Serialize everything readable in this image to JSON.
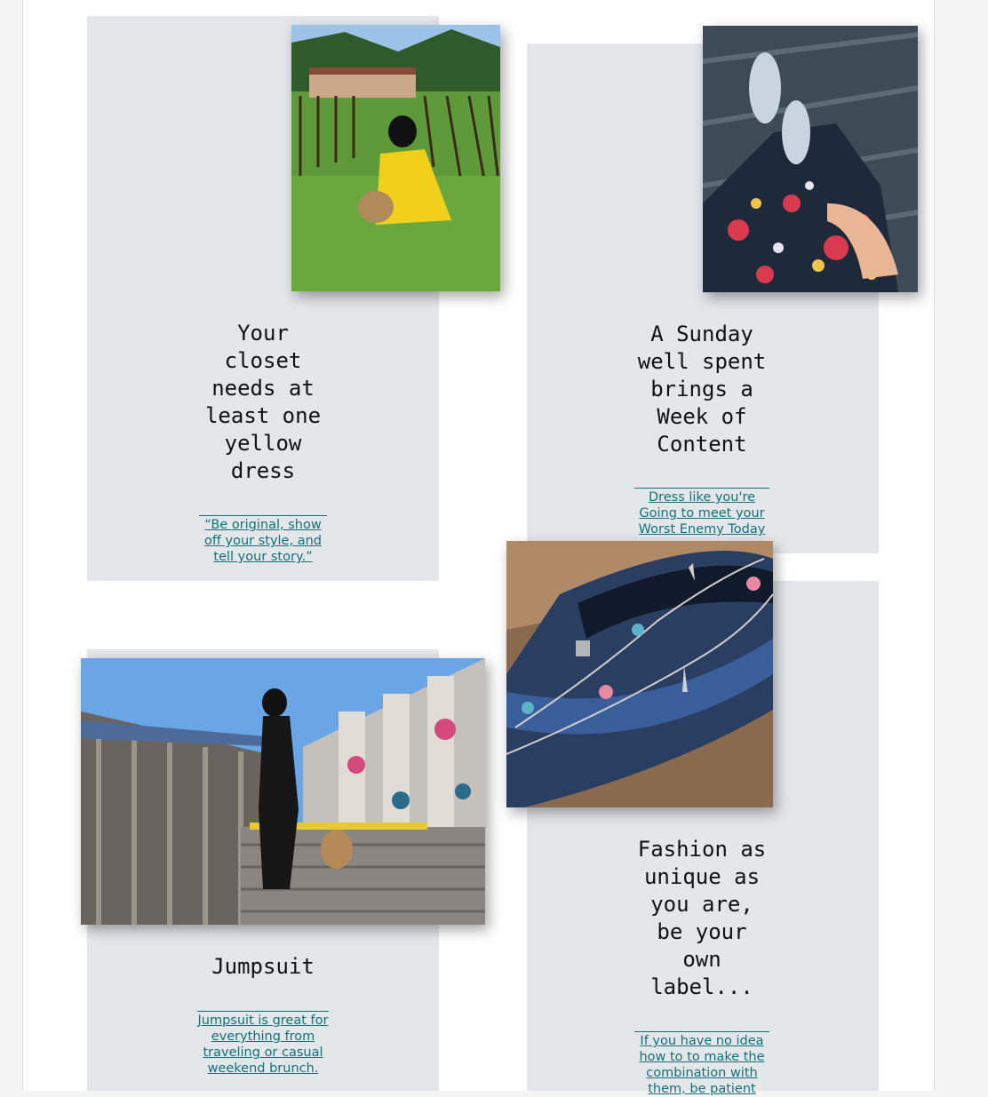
{
  "cards": [
    {
      "title": "Your closet needs at least one yellow dress",
      "link": "“Be original, show off your style, and tell your story.”",
      "photo": "woman-yellow-dress-vineyard-photo"
    },
    {
      "title": "A Sunday well spent brings a Week of Content",
      "link": "Dress like you're Going to meet your Worst Enemy Today",
      "photo": "floral-dress-sandals-photo"
    },
    {
      "title": "Jumpsuit",
      "link": "Jumpsuit is great for everything from traveling or casual weekend brunch.",
      "photo": "jumpsuit-graffiti-stairs-photo"
    },
    {
      "title": "Fashion as unique as you are, be your own label...",
      "link": "If you have no idea how to to make the combination with them, be patient",
      "photo": "charm-bracelet-photo"
    }
  ],
  "colors": {
    "card_bg": "#e3e7ea",
    "link": "#137178",
    "title": "#111111"
  }
}
